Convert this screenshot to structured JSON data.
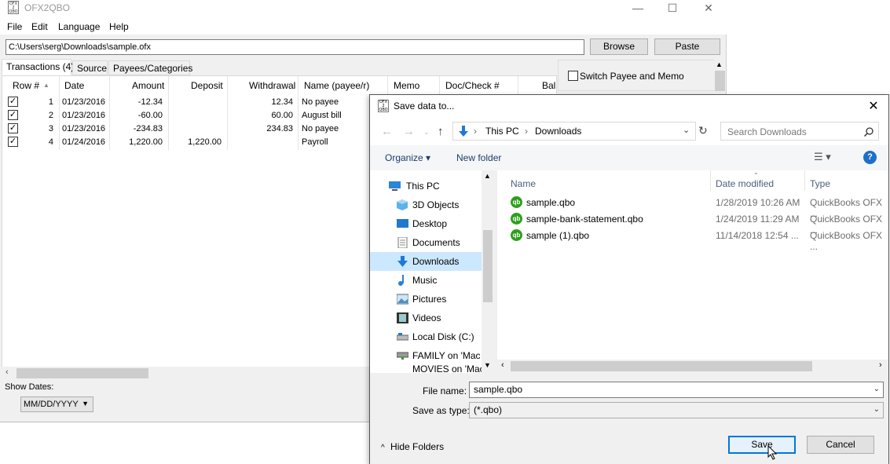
{
  "app": {
    "title": "OFX2QBO",
    "icon_text": "OFX 2 QBO",
    "window_controls": [
      "—",
      "☐",
      "✕"
    ]
  },
  "menu": [
    "File",
    "Edit",
    "Language",
    "Help"
  ],
  "path_input": "C:\\Users\\serg\\Downloads\\sample.ofx",
  "buttons": {
    "browse": "Browse",
    "paste": "Paste"
  },
  "tabs": [
    "Transactions (4)",
    "Source",
    "Payees/Categories"
  ],
  "grid": {
    "columns": [
      "Row #",
      "Date",
      "Amount",
      "Deposit",
      "Withdrawal",
      "Name (payee/r)",
      "Memo",
      "Doc/Check #",
      "Bal"
    ],
    "rows": [
      {
        "checked": true,
        "row": "1",
        "date": "01/23/2016",
        "amount": "-12.34",
        "deposit": "",
        "withdrawal": "12.34",
        "name": "No payee"
      },
      {
        "checked": true,
        "row": "2",
        "date": "01/23/2016",
        "amount": "-60.00",
        "deposit": "",
        "withdrawal": "60.00",
        "name": "August bill"
      },
      {
        "checked": true,
        "row": "3",
        "date": "01/23/2016",
        "amount": "-234.83",
        "deposit": "",
        "withdrawal": "234.83",
        "name": "No payee"
      },
      {
        "checked": true,
        "row": "4",
        "date": "01/24/2016",
        "amount": "1,220.00",
        "deposit": "1,220.00",
        "withdrawal": "",
        "name": "Payroll"
      }
    ]
  },
  "switch_payee_memo": {
    "label": "Switch Payee and Memo",
    "checked": false
  },
  "show_dates": {
    "label": "Show Dates:",
    "value": "MM/DD/YYYY"
  },
  "dialog": {
    "title": "Save data to...",
    "breadcrumb": [
      "This PC",
      "Downloads"
    ],
    "search_placeholder": "Search Downloads",
    "toolbar": {
      "organize": "Organize",
      "new_folder": "New folder"
    },
    "nav": [
      "This PC",
      "3D Objects",
      "Desktop",
      "Documents",
      "Downloads",
      "Music",
      "Pictures",
      "Videos",
      "Local Disk (C:)",
      "FAMILY on 'Mac",
      "MOVIES on 'Mac"
    ],
    "selected_nav": "Downloads",
    "columns": [
      "Name",
      "Date modified",
      "Type"
    ],
    "files": [
      {
        "name": "sample.qbo",
        "date": "1/28/2019 10:26 AM",
        "type": "QuickBooks OFX ..."
      },
      {
        "name": "sample-bank-statement.qbo",
        "date": "1/24/2019 11:29 AM",
        "type": "QuickBooks OFX ..."
      },
      {
        "name": "sample (1).qbo",
        "date": "11/14/2018 12:54 ...",
        "type": "QuickBooks OFX ..."
      }
    ],
    "file_name_label": "File name:",
    "file_name": "sample.qbo",
    "save_type_label": "Save as type:",
    "save_type": "(*.qbo)",
    "hide_folders": "Hide Folders",
    "save": "Save",
    "cancel": "Cancel"
  },
  "colors": {
    "accent": "#0078d7",
    "selection": "#cce8ff",
    "qb_green": "#2ca01c"
  }
}
